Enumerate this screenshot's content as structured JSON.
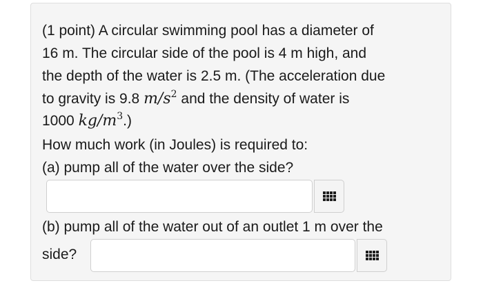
{
  "problem": {
    "lines": {
      "l1": "(1 point) A circular swimming pool has a diameter of",
      "l2": "16 m. The circular side of the pool is 4 m high, and",
      "l3": "the depth of the water is 2.5 m. (The acceleration due",
      "l4_pre": "to gravity is 9.8 ",
      "l4_math": "m/s",
      "l4_exp": "2",
      "l4_post": " and the density of water is",
      "l5_pre": "1000 ",
      "l5_math": "kg/m",
      "l5_exp": "3",
      "l5_post": ".)",
      "l6": "How much work (in Joules) is required to:",
      "l7": "(a) pump all of the water over the side?",
      "l8": "(b) pump all of the water out of an outlet 1 m over the",
      "l9": "side?"
    }
  },
  "answers": {
    "part_a": {
      "value": "",
      "button_icon": "matrix-grid-icon"
    },
    "part_b": {
      "value": "",
      "button_icon": "matrix-grid-icon"
    }
  }
}
